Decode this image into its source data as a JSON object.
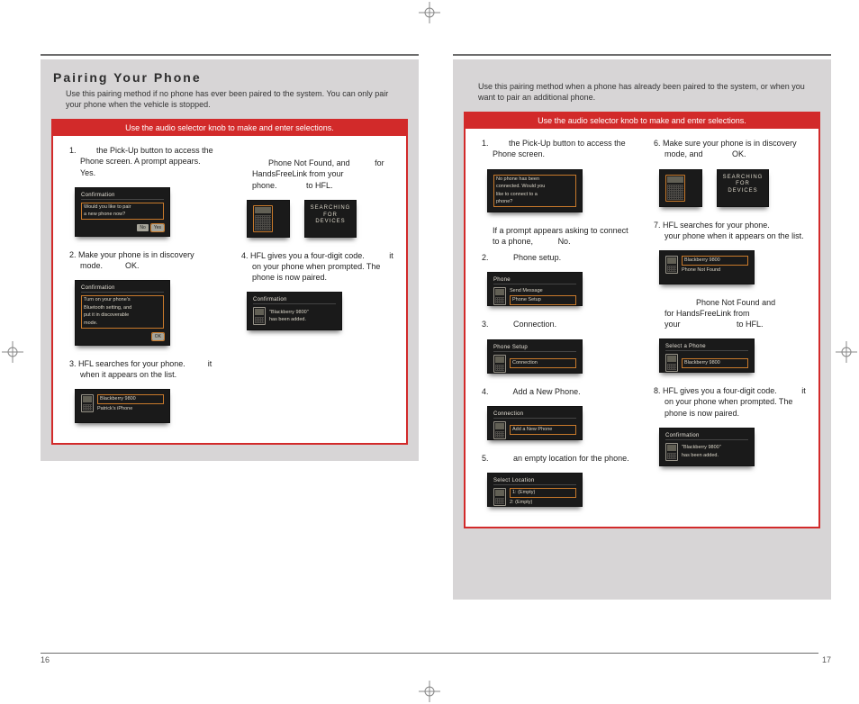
{
  "title": "Pairing Your Phone",
  "left": {
    "intro": "Use this pairing method if no phone has ever been paired to the system. You can only pair your phone when the vehicle is stopped.",
    "panel_head": "Use the audio selector knob to make and enter selections.",
    "steps": {
      "s1a": "1.",
      "s1b": "the Pick-Up button to access the Phone screen.  A prompt appears.",
      "s1c": "Yes.",
      "s2a": "2.  Make your phone is in discovery mode.",
      "s2c": "OK.",
      "s3a": "3.  HFL searches for your phone.",
      "s3b": "it when it appears on the list.",
      "r1a": "Phone Not Found, and",
      "r1b": "for HandsFreeLink from your phone.",
      "r1c": "to HFL.",
      "r2": "4.  HFL gives you a four-digit code.",
      "r2b": "it on your phone when prompted. The phone is now paired."
    },
    "shots": {
      "a_title": "Confirmation",
      "a_l1": "Would you like to pair",
      "a_l2": "a new phone now?",
      "a_b1": "No",
      "a_b2": "Yes",
      "b_title": "Confirmation",
      "b_l1": "Turn on your phone's",
      "b_l2": "Bluetooth setting, and",
      "b_l3": "put it in discoverable",
      "b_l4": "mode.",
      "b_b1": "OK",
      "c_l1": "Blackberry 9800",
      "c_l2": "Patrick's iPhone",
      "d_search": "SEARCHING\nFOR DEVICES",
      "e_title": "Confirmation",
      "e_l1": "\"Blackberry 9800\"",
      "e_l2": "has been added."
    }
  },
  "right": {
    "intro": "Use this pairing method when a phone has already been paired to the system, or when you want to pair an additional phone.",
    "panel_head": "Use the audio selector knob to make and enter selections.",
    "L": {
      "s1a": "1.",
      "s1b": "the Pick-Up button to access the Phone screen.",
      "s1c": "If a prompt appears asking to connect to a phone,",
      "s1d": "No.",
      "s2": "2.",
      "s2b": "Phone setup.",
      "s3": "3.",
      "s3b": "Connection.",
      "s4": "4.",
      "s4b": "Add a New Phone.",
      "s5": "5.",
      "s5b": "an empty location for the phone."
    },
    "R": {
      "s6a": "6.  Make sure your phone is in discovery mode, and",
      "s6b": "OK.",
      "s7a": "7.  HFL searches for your phone.",
      "s7b": "your phone when it appears on the list.",
      "note_a": "Phone Not Found and",
      "note_b": "for HandsFreeLink from your",
      "note_c": "to HFL.",
      "s8a": "8.  HFL gives you a four-digit code.",
      "s8b": "it on your phone when prompted. The phone is now paired."
    },
    "shots": {
      "p1_l1": "No phone has been",
      "p1_l2": "connected. Would you",
      "p1_l3": "like to connect to a",
      "p1_l4": "phone?",
      "p2_title": "Phone",
      "p2_l1": "Send Message",
      "p2_l2": "Phone Setup",
      "p3_title": "Phone Setup",
      "p3_l1": "Connection",
      "p4_title": "Connection",
      "p4_l1": "Add a New Phone",
      "p5_title": "Select Location",
      "p5_l1": "1: (Empty)",
      "p5_l2": "2: (Empty)",
      "q1_search": "SEARCHING\nFOR DEVICES",
      "q2_l1": "Blackberry 9800",
      "q2_l2": "Phone Not Found",
      "q3_title": "Select a Phone",
      "q3_l1": "Blackberry 9800",
      "q4_title": "Confirmation",
      "q4_l1": "\"Blackberry 9800\"",
      "q4_l2": "has been added."
    }
  },
  "page_left": "16",
  "page_right": "17"
}
